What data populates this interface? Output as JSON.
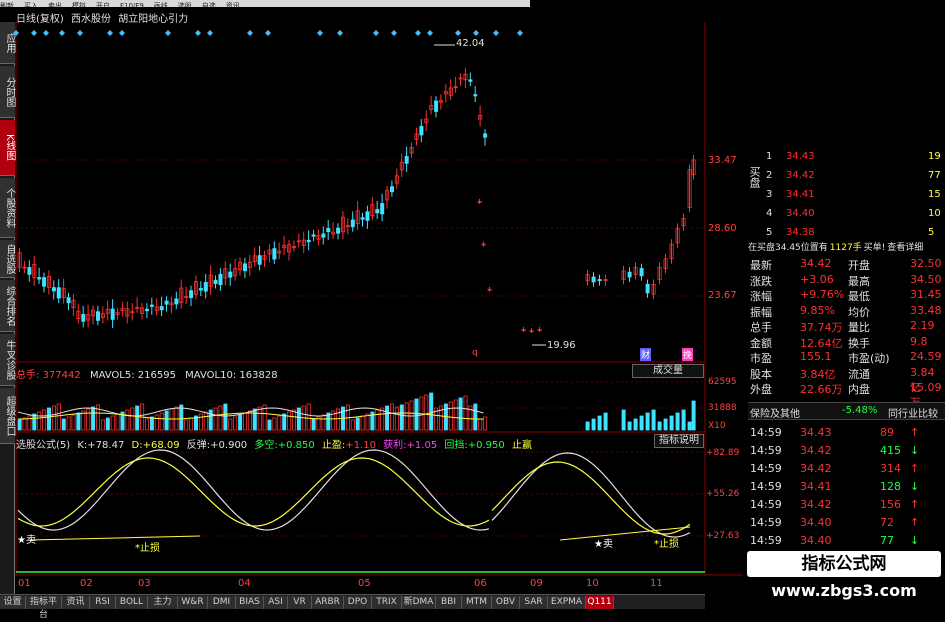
{
  "menubar": [
    "刷新",
    "买入",
    "卖出",
    "模拟",
    "开户",
    "F10/F9",
    "画线",
    "选股",
    "自选",
    "资讯"
  ],
  "side_tabs": [
    {
      "label": "应用",
      "active": false
    },
    {
      "label": "分时图",
      "active": false
    },
    {
      "label": "K线图",
      "active": true
    },
    {
      "label": "个股资料",
      "active": false
    },
    {
      "label": "自选股",
      "active": false
    },
    {
      "label": "综合排名",
      "active": false
    },
    {
      "label": "牛叉诊股",
      "active": false
    },
    {
      "label": "超级盘口",
      "active": false
    }
  ],
  "header": {
    "period": "日线(复权)",
    "stock": "西水股份",
    "indicator": "胡立阳地心引力"
  },
  "price_chart": {
    "y_ticks": [
      "33.47",
      "28.60",
      "23.67"
    ],
    "high_label": "42.04",
    "low_label": "19.96",
    "marker_q": "q",
    "marker_cai": "财",
    "marker_wan": "挽"
  },
  "volume_header": {
    "total_label": "总手:",
    "total_value": "377442",
    "mavol5_label": "MAVOL5:",
    "mavol5_value": "216595",
    "mavol10_label": "MAVOL10:",
    "mavol10_value": "163828",
    "dropdown": "成交量",
    "y_ticks": [
      "62595",
      "31888",
      "X10"
    ]
  },
  "indicator_header": {
    "name": "选股公式(5)",
    "k_label": "K:",
    "k_value": "+78.47",
    "d_label": "D:",
    "d_value": "+68.09",
    "fantan_label": "反弹:",
    "fantan_value": "+0.900",
    "duokong_label": "多空:",
    "duokong_value": "+0.850",
    "zhiying_label": "止盈:",
    "zhiying_value": "+1.10",
    "zhuanli_label": "获利:",
    "zhuanli_value": "+1.05",
    "huidang_label": "回挡:",
    "huidang_value": "+0.950",
    "end_label": "止赢",
    "explain_button": "指标说明",
    "y_ticks": [
      "+82.89",
      "+55.26",
      "+27.63"
    ],
    "buy_label": "卖",
    "stop_label": "止损",
    "buy_label2": "卖",
    "stop_label2": "止损"
  },
  "x_axis": [
    "01",
    "02",
    "03",
    "04",
    "05",
    "06",
    "09",
    "10",
    "11"
  ],
  "orderbook": {
    "side_label_buy": "买盘",
    "rows": [
      {
        "level": "1",
        "price": "34.43",
        "vol": "19"
      },
      {
        "level": "2",
        "price": "34.42",
        "vol": "77"
      },
      {
        "level": "3",
        "price": "34.41",
        "vol": "15"
      },
      {
        "level": "4",
        "price": "34.40",
        "vol": "10"
      },
      {
        "level": "5",
        "price": "34.38",
        "vol": "5"
      }
    ],
    "info_line": "在买盘34.45位置有",
    "info_vol": "1127手",
    "info_buy": "买单!",
    "info_link": "查看详细"
  },
  "quote": [
    {
      "l": "最新",
      "v": "34.42",
      "l2": "开盘",
      "v2": "32.50"
    },
    {
      "l": "涨跌",
      "v": "+3.06",
      "l2": "最高",
      "v2": "34.50"
    },
    {
      "l": "涨幅",
      "v": "+9.76%",
      "l2": "最低",
      "v2": "31.45"
    },
    {
      "l": "振幅",
      "v": "9.85%",
      "l2": "均价",
      "v2": "33.48"
    },
    {
      "l": "总手",
      "v": "37.74万",
      "l2": "量比",
      "v2": "2.19"
    },
    {
      "l": "金额",
      "v": "12.64亿",
      "l2": "换手",
      "v2": "9.8"
    },
    {
      "l": "市盈",
      "v": "155.1",
      "l2": "市盈(动)",
      "v2": "24.59"
    },
    {
      "l": "股本",
      "v": "3.84亿",
      "l2": "流通",
      "v2": "3.84亿"
    },
    {
      "l": "外盘",
      "v": "22.66万",
      "l2": "内盘",
      "v2": "15.09万"
    }
  ],
  "industry": {
    "name": "保险及其他",
    "change": "-5.48%",
    "compare": "同行业比较"
  },
  "ticks": [
    {
      "t": "14:59",
      "p": "34.43",
      "v": "89",
      "dir": "up"
    },
    {
      "t": "14:59",
      "p": "34.42",
      "v": "415",
      "dir": "down"
    },
    {
      "t": "14:59",
      "p": "34.42",
      "v": "314",
      "dir": "up"
    },
    {
      "t": "14:59",
      "p": "34.41",
      "v": "128",
      "dir": "down"
    },
    {
      "t": "14:59",
      "p": "34.42",
      "v": "156",
      "dir": "up"
    },
    {
      "t": "14:59",
      "p": "34.40",
      "v": "72",
      "dir": "up"
    },
    {
      "t": "14:59",
      "p": "34.40",
      "v": "77",
      "dir": "down"
    }
  ],
  "bottom_tabs": [
    {
      "label": "设置",
      "active": false
    },
    {
      "label": "指标平台",
      "active": false
    },
    {
      "label": "资讯",
      "active": false
    },
    {
      "label": "RSI",
      "active": false
    },
    {
      "label": "BOLL",
      "active": false
    },
    {
      "label": "主力",
      "active": false
    },
    {
      "label": "W&R",
      "active": false
    },
    {
      "label": "DMI",
      "active": false
    },
    {
      "label": "BIAS",
      "active": false
    },
    {
      "label": "ASI",
      "active": false
    },
    {
      "label": "VR",
      "active": false
    },
    {
      "label": "ARBR",
      "active": false
    },
    {
      "label": "DPO",
      "active": false
    },
    {
      "label": "TRIX",
      "active": false
    },
    {
      "label": "新DMA",
      "active": false
    },
    {
      "label": "BBI",
      "active": false
    },
    {
      "label": "MTM",
      "active": false
    },
    {
      "label": "OBV",
      "active": false
    },
    {
      "label": "SAR",
      "active": false
    },
    {
      "label": "EXPMA",
      "active": false
    },
    {
      "label": "Q111",
      "active": true
    }
  ],
  "watermark": {
    "title": "指标公式网",
    "url": "www.zbgs3.com"
  },
  "colors": {
    "up": "#ff3030",
    "down": "#40e0ff",
    "neutral": "#e0e0e0",
    "yellow": "#ffff40",
    "green": "#20ff40",
    "accent": "#b00010"
  }
}
